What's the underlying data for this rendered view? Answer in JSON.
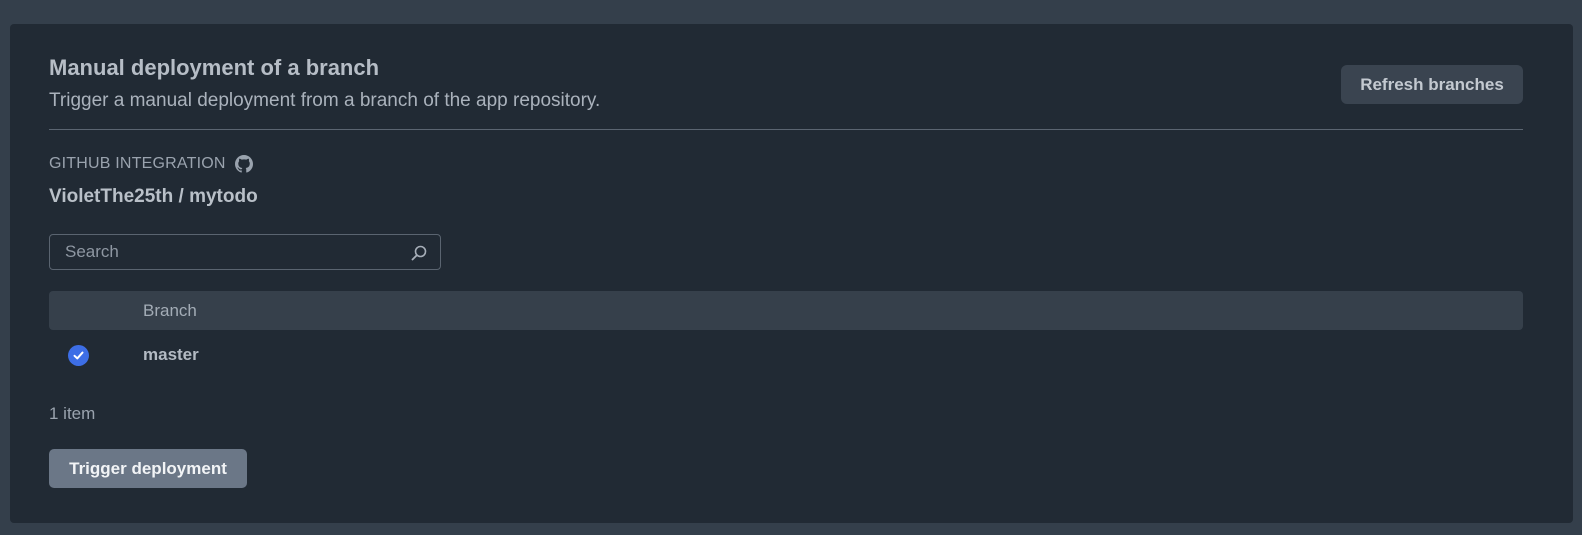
{
  "panel": {
    "title": "Manual deployment of a branch",
    "subtitle": "Trigger a manual deployment from a branch of the app repository.",
    "refresh_label": "Refresh branches"
  },
  "integration": {
    "label": "GITHUB INTEGRATION",
    "icon": "github-icon",
    "repository": "VioletThe25th / mytodo"
  },
  "search": {
    "placeholder": "Search",
    "value": "",
    "icon": "search-icon"
  },
  "table": {
    "columns": [
      "Branch"
    ],
    "rows": [
      {
        "branch": "master",
        "selected": true
      }
    ]
  },
  "footer": {
    "item_count": "1 item",
    "trigger_label": "Trigger deployment"
  },
  "colors": {
    "background": "#343f4b",
    "card": "#212a34",
    "selected_radio": "#3d6ee6",
    "primary_button": "#6b7787"
  }
}
